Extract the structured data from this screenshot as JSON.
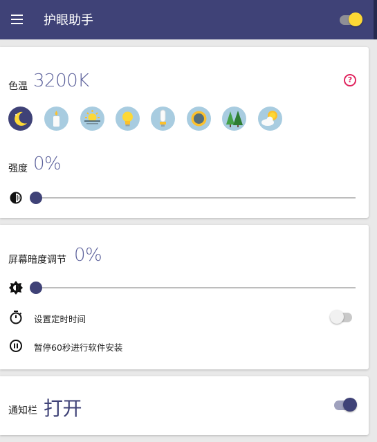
{
  "app_bar": {
    "title": "护眼助手",
    "master_switch_on": true
  },
  "color_temp": {
    "label": "色温",
    "value": "3200K",
    "help_glyph": "?",
    "presets": [
      "moon-icon",
      "candle-icon",
      "sunrise-icon",
      "bulb-icon",
      "fluorescent-icon",
      "sun-icon",
      "forest-icon",
      "cloud-sun-icon"
    ],
    "selected_preset": 0
  },
  "intensity": {
    "label": "强度",
    "value": "0%",
    "level": 0
  },
  "dim": {
    "label": "屏幕暗度调节",
    "value": "0%",
    "level": 0
  },
  "timer": {
    "label": "设置定时时间",
    "on": false
  },
  "pause": {
    "label": "暂停60秒进行软件安装"
  },
  "notify": {
    "label": "通知栏",
    "value": "打开",
    "on": true
  },
  "colors": {
    "primary": "#3f4277",
    "accent_yellow": "#fdd835",
    "help_red": "#e0245e",
    "value_text": "#5a5f9a"
  }
}
